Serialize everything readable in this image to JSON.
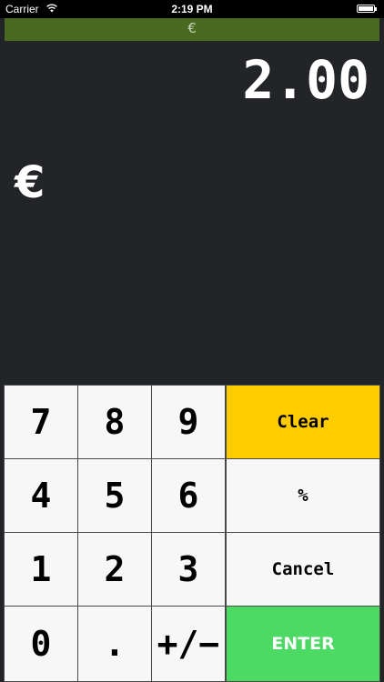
{
  "status_bar": {
    "carrier": "Carrier",
    "time": "2:19 PM"
  },
  "nav": {
    "title": "€"
  },
  "display": {
    "value": "2.00",
    "currency_symbol": "€"
  },
  "keypad": {
    "keys": [
      "7",
      "8",
      "9",
      "4",
      "5",
      "6",
      "1",
      "2",
      "3",
      "0",
      ".",
      "+/−"
    ],
    "clear_label": "Clear",
    "percent_label": "%",
    "cancel_label": "Cancel",
    "enter_label": "ENTER"
  },
  "colors": {
    "navbar": "#4a6a22",
    "background": "#222428",
    "clear": "#ffcc00",
    "enter": "#4cd964"
  }
}
